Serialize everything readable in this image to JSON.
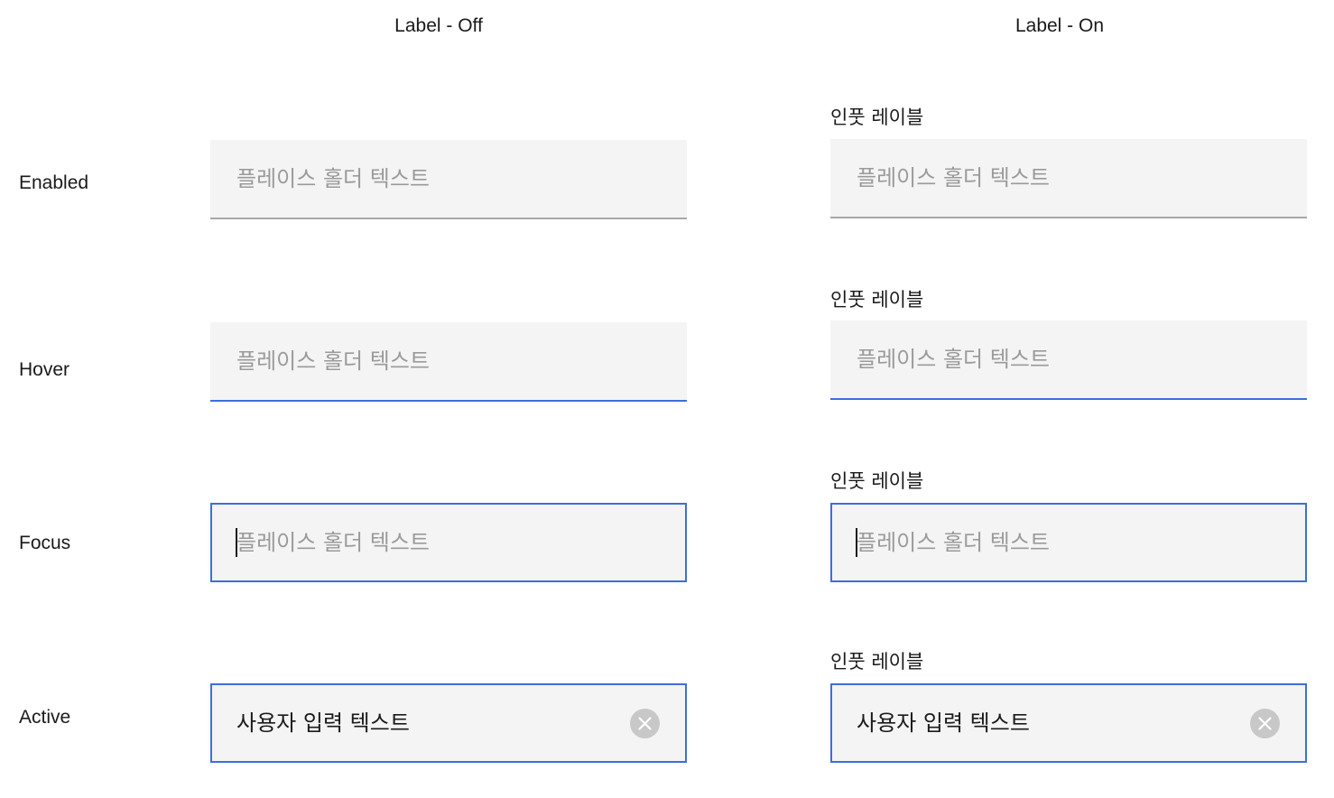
{
  "columns": {
    "label_off": "Label - Off",
    "label_on": "Label - On"
  },
  "rows": {
    "enabled": "Enabled",
    "hover": "Hover",
    "focus": "Focus",
    "active": "Active"
  },
  "input_label": "인풋 레이블",
  "placeholder": "플레이스 홀더 텍스트",
  "user_input": "사용자 입력 텍스트",
  "colors": {
    "field_bg": "#f4f4f4",
    "enabled_underline": "#a8a8a8",
    "accent_blue": "#3d6fd9",
    "placeholder_text": "#9a9a9a",
    "clear_icon_bg": "#c8c8c8"
  },
  "icons": {
    "clear": "close-circle-icon"
  }
}
